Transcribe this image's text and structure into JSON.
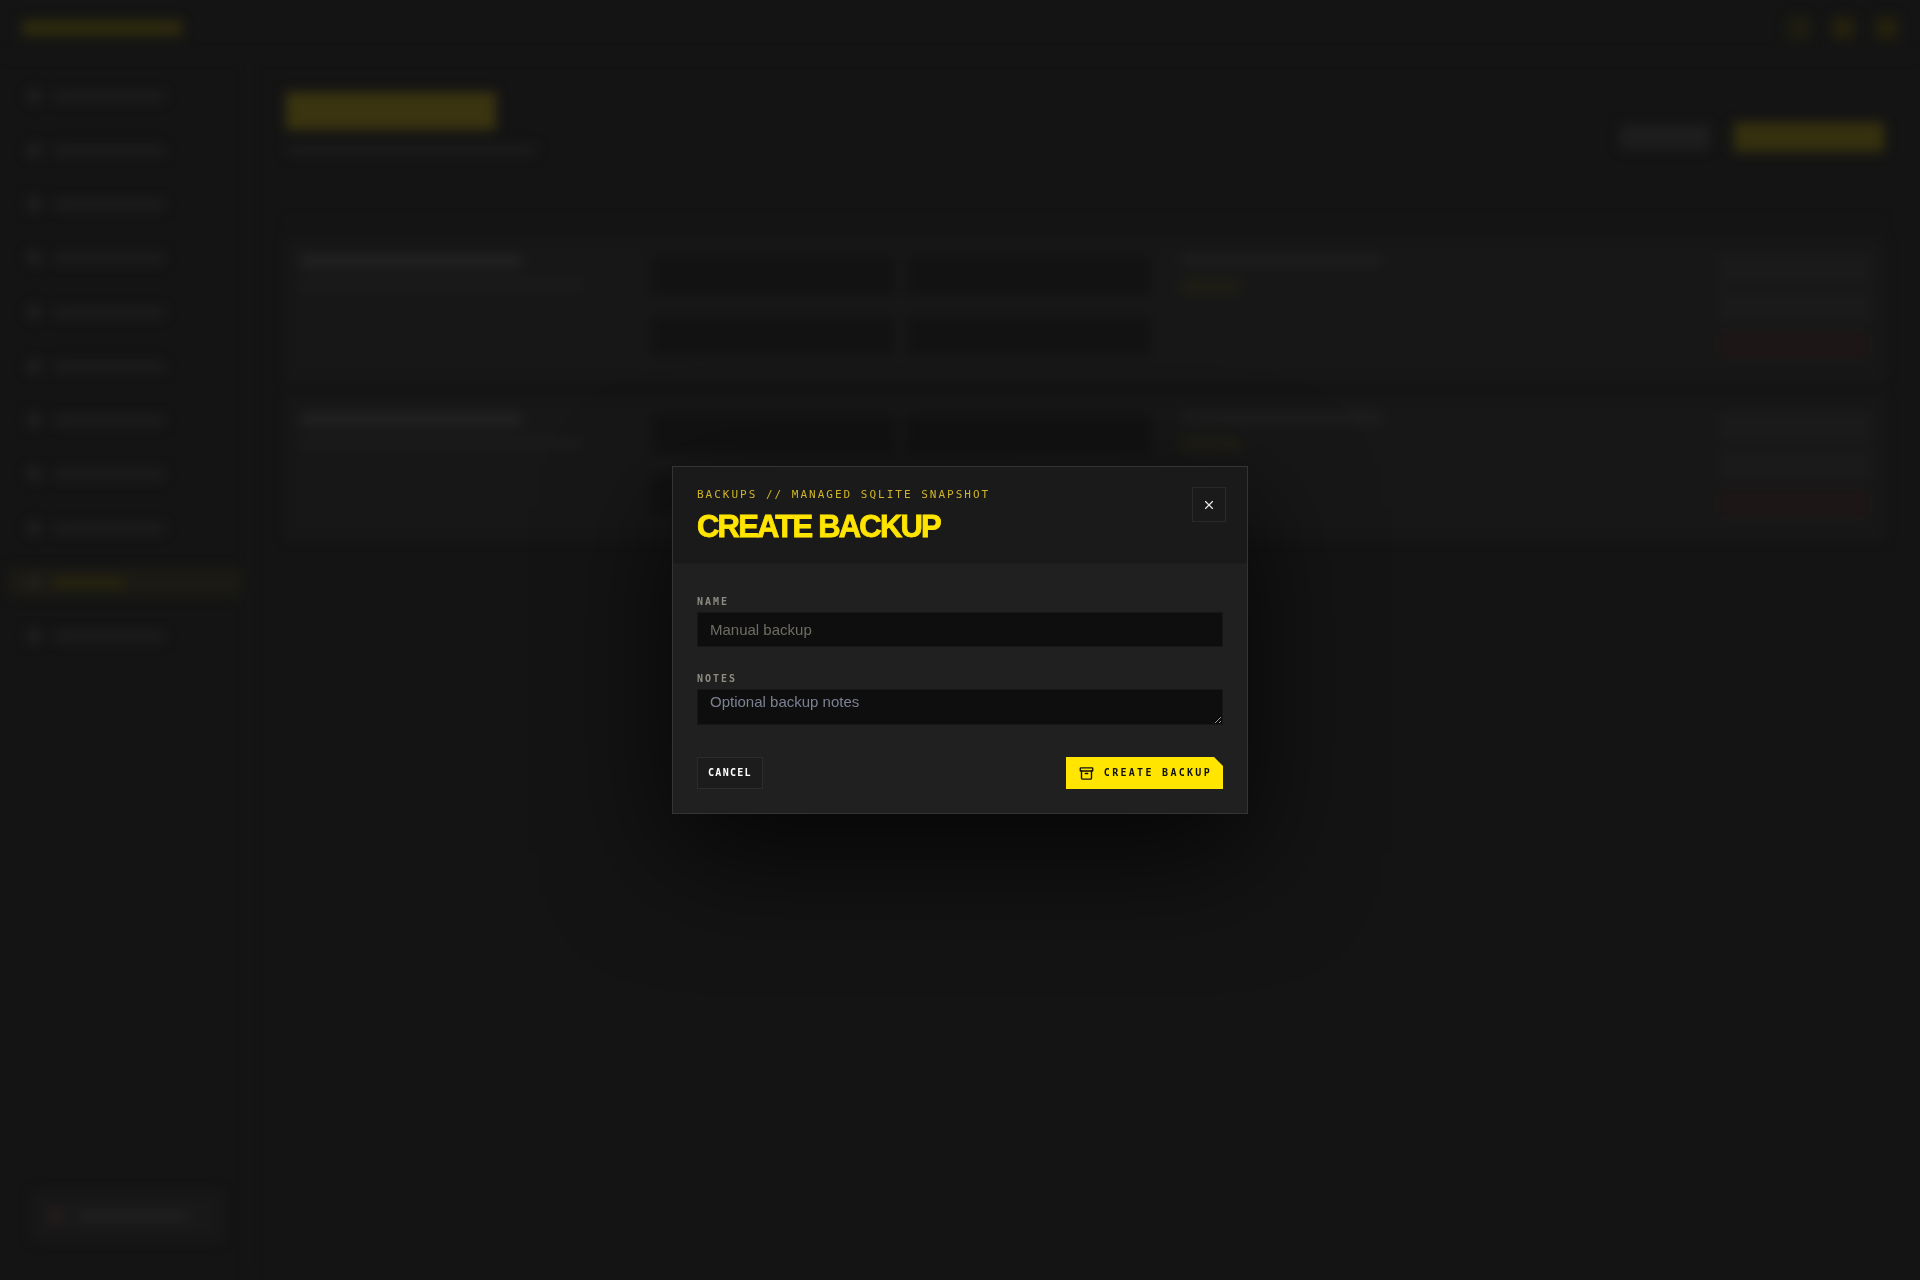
{
  "dialog": {
    "eyebrow": "BACKUPS // MANAGED SQLITE SNAPSHOT",
    "title": "CREATE BACKUP",
    "fields": [
      {
        "kind": "input",
        "label": "NAME",
        "placeholder": "Manual backup"
      },
      {
        "kind": "textarea",
        "label": "NOTES",
        "placeholder": "Optional backup notes"
      }
    ],
    "actions": [
      {
        "kind": "secondary",
        "label": "CANCEL"
      },
      {
        "kind": "primary",
        "label": "CREATE BACKUP"
      }
    ]
  }
}
